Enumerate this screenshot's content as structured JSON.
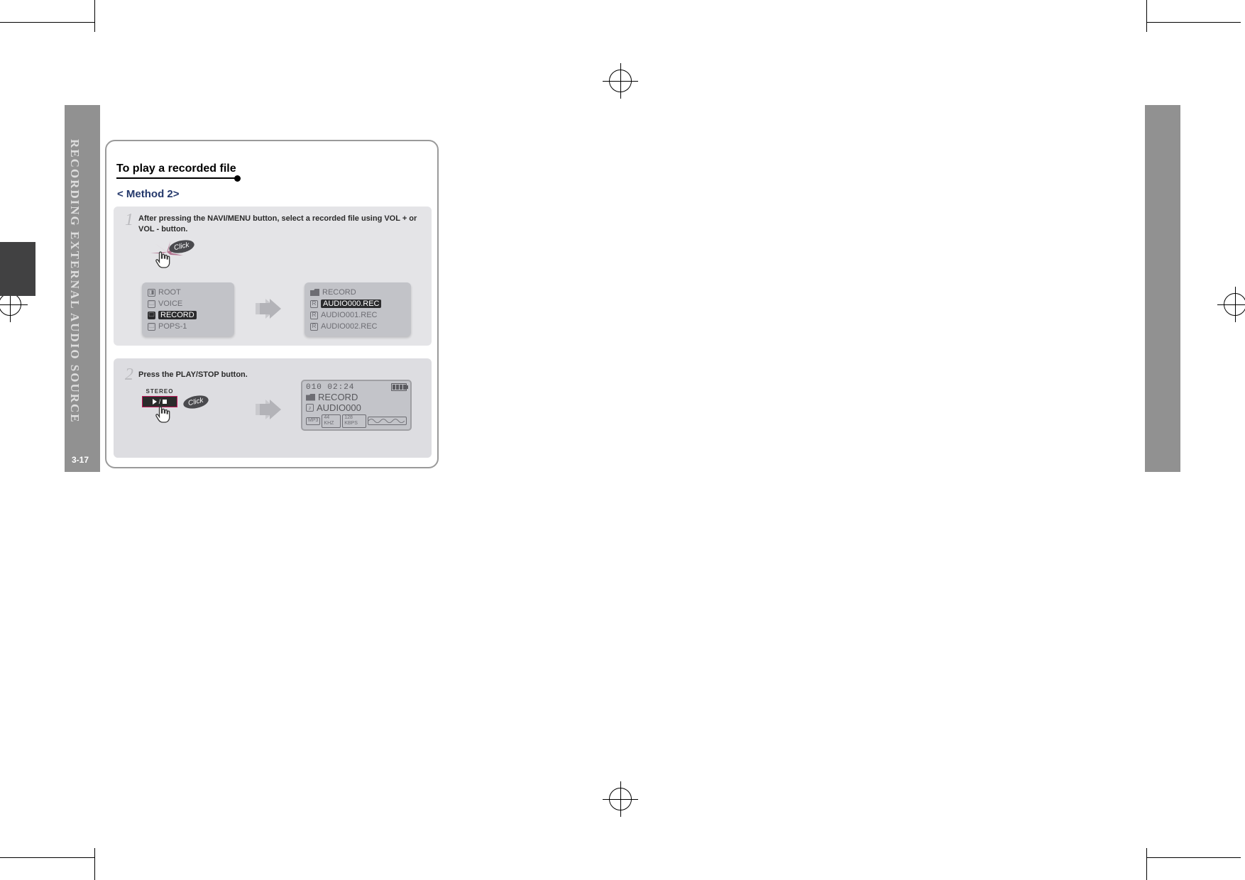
{
  "sidebar": {
    "title": "RECORDING EXTERNAL AUDIO SOURCE",
    "page": "3-17"
  },
  "section": {
    "title": "To play a recorded file",
    "subhead": "< Method 2>"
  },
  "steps": {
    "one": {
      "num": "1",
      "text": "After pressing the NAVI/MENU button, select a recorded file using VOL + or VOL - button.",
      "click": "Click",
      "screenA": {
        "r1": "ROOT",
        "r2": "VOICE",
        "r3": "RECORD",
        "r4": "POPS-1"
      },
      "screenB": {
        "r1": "RECORD",
        "r2": "AUDIO000.REC",
        "r3": "AUDIO001.REC",
        "r4": "AUDIO002.REC"
      }
    },
    "two": {
      "num": "2",
      "text": "Press the PLAY/STOP button.",
      "stereo": "STEREO",
      "click": "Click",
      "play": {
        "counter": "010 02:24",
        "folder": "RECORD",
        "file": "AUDIO000",
        "chip1": "MP3",
        "chip2": "44 KHZ",
        "chip3": "128 KBPS"
      }
    }
  }
}
